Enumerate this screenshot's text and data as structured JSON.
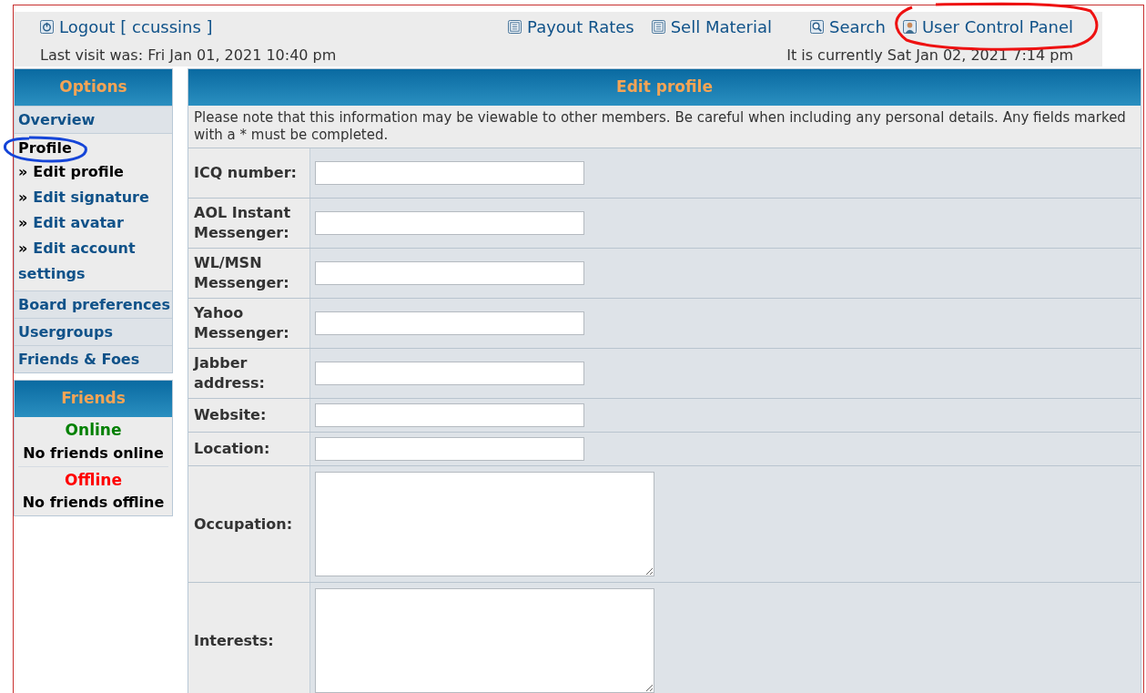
{
  "header": {
    "logout": "Logout [ ccussins ]",
    "links": [
      {
        "label": "Payout Rates"
      },
      {
        "label": "Sell Material"
      },
      {
        "label": "Search"
      },
      {
        "label": "User Control Panel"
      }
    ],
    "last_visit": "Last visit was: Fri Jan 01, 2021 10:40 pm",
    "current_time": "It is currently Sat Jan 02, 2021 7:14 pm"
  },
  "sidebar": {
    "title": "Options",
    "sections": [
      {
        "label": "Overview",
        "selected": false
      },
      {
        "label": "Profile",
        "selected": true,
        "children": [
          {
            "bullet": "»",
            "label": "Edit profile",
            "selected": true
          },
          {
            "bullet": "»",
            "label": "Edit signature",
            "selected": false
          },
          {
            "bullet": "»",
            "label": "Edit avatar",
            "selected": false
          },
          {
            "bullet": "»",
            "label": "Edit account settings",
            "selected": false
          }
        ]
      },
      {
        "label": "Board preferences",
        "selected": false
      },
      {
        "label": "Usergroups",
        "selected": false
      },
      {
        "label": "Friends & Foes",
        "selected": false
      }
    ]
  },
  "friends": {
    "title": "Friends",
    "groups": [
      {
        "status": "Online",
        "color": "#008000",
        "text": "No friends online"
      },
      {
        "status": "Offline",
        "color": "#ff0000",
        "text": "No friends offline"
      }
    ]
  },
  "form": {
    "title": "Edit profile",
    "note": "Please note that this information may be viewable to other members. Be careful when including any personal details. Any fields marked with a * must be completed.",
    "fields": [
      {
        "label": "ICQ number:",
        "kind": "input"
      },
      {
        "label": "AOL Instant Messenger:",
        "kind": "input"
      },
      {
        "label": "WL/MSN Messenger:",
        "kind": "input"
      },
      {
        "label": "Yahoo Messenger:",
        "kind": "input"
      },
      {
        "label": "Jabber address:",
        "kind": "input"
      },
      {
        "label": "Website:",
        "kind": "input"
      },
      {
        "label": "Location:",
        "kind": "input"
      },
      {
        "label": "Occupation:",
        "kind": "textarea"
      },
      {
        "label": "Interests:",
        "kind": "textarea"
      }
    ]
  }
}
